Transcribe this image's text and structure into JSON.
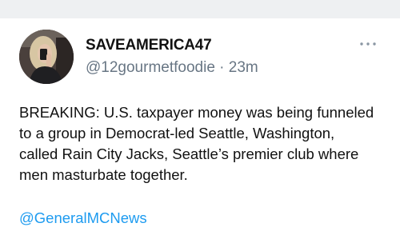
{
  "post": {
    "author": {
      "display_name": "SAVEAMERICA47",
      "handle": "@12gourmetfoodie",
      "separator": "·",
      "time": "23m",
      "avatar_icon": "profile-photo"
    },
    "more_icon": "more-dots-icon",
    "text_lines": [
      "BREAKING: U.S. taxpayer money was being funneled",
      "to a group in Democrat-led Seattle, Washington,",
      "called Rain City Jacks, Seattle’s premier club where",
      "men masturbate together."
    ],
    "mention": "@GeneralMCNews"
  },
  "colors": {
    "text_primary": "#111111",
    "text_secondary": "#687684",
    "link": "#1d9bf0",
    "top_strip": "#eef0f2"
  }
}
